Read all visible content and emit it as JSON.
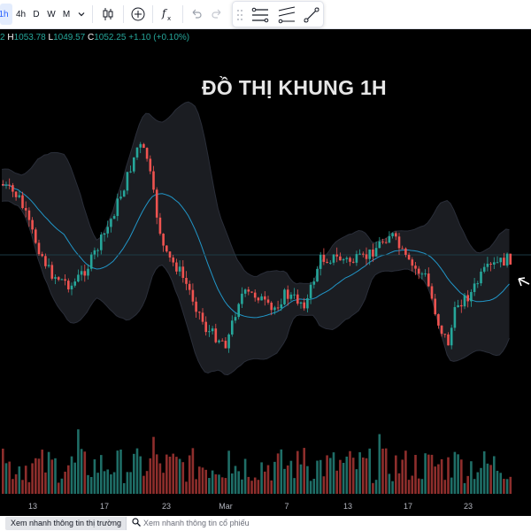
{
  "toolbar": {
    "interval_active": "1h",
    "intervals": [
      "4h",
      "D",
      "W",
      "M"
    ],
    "icons": [
      "chevron-down-icon",
      "candles-icon",
      "plus-circle-icon",
      "indicators-icon",
      "undo-icon",
      "redo-icon"
    ],
    "float_icons": [
      "drag-handle-icon",
      "lines-icon",
      "fib-icon",
      "trendline-icon"
    ]
  },
  "ohlc": {
    "o_label": "2",
    "h_label": "H",
    "h_value": "1053.78",
    "l_label": "L",
    "l_value": "1049.57",
    "c_label": "C",
    "c_value": "1052.25",
    "change": "+1.10 (+0.10%)"
  },
  "chart_title": "ĐỒ THỊ KHUNG 1H",
  "colors": {
    "up": "#26a69a",
    "down": "#ef5350",
    "basis": "#2196c8",
    "band_fill": "#1b1d22",
    "band_line": "#2a2e39"
  },
  "chart_data": {
    "type": "candlestick",
    "title": "ĐỒ THỊ KHUNG 1H",
    "x_tick_labels": [
      "13",
      "17",
      "23",
      "Mar",
      "7",
      "13",
      "17",
      "23"
    ],
    "close_last": 1052.25,
    "high_last": 1053.78,
    "low_last": 1049.57,
    "change_last": 1.1,
    "change_pct_last": 0.1,
    "indicators": [
      "Bollinger Bands",
      "Volume"
    ],
    "grid": false,
    "legend": "none"
  },
  "bottom": {
    "market_btn": "Xem nhanh thông tin thị trường",
    "stock_search": "Xem nhanh thông tin cổ phiếu"
  }
}
